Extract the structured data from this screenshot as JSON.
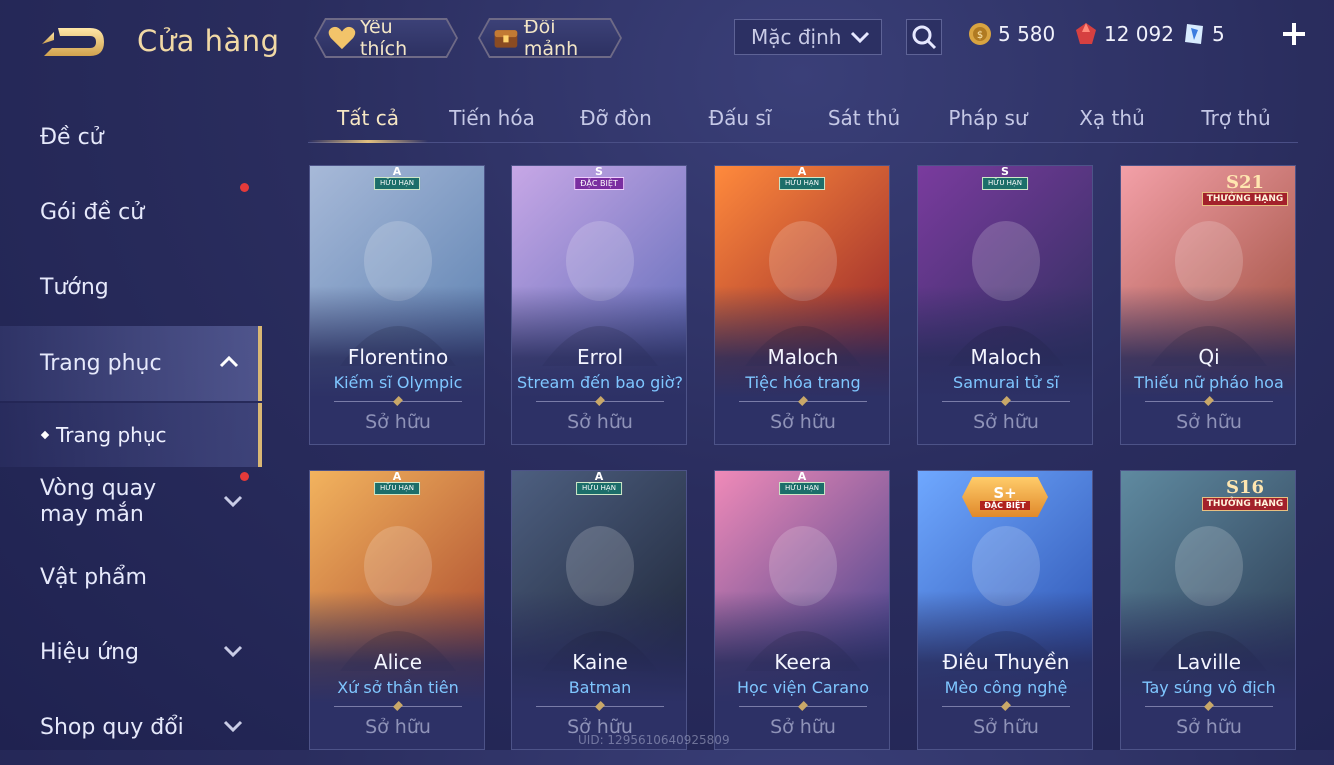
{
  "header": {
    "title": "Cửa hàng",
    "favorites_label": "Yêu thích",
    "exchange_label": "Đổi mảnh",
    "sort_value": "Mặc định",
    "currencies": [
      {
        "icon": "gold-coin-icon",
        "value": "5 580"
      },
      {
        "icon": "red-gem-icon",
        "value": "12 092"
      },
      {
        "icon": "blue-voucher-icon",
        "value": "5"
      }
    ]
  },
  "sidebar": {
    "items": [
      {
        "label": "Đề cử"
      },
      {
        "label": "Gói đề cử"
      },
      {
        "label": "Tướng"
      },
      {
        "label": "Trang phục"
      },
      {
        "label": "Trang phục"
      },
      {
        "label": "Vòng quay may mắn"
      },
      {
        "label": "Vật phẩm"
      },
      {
        "label": "Hiệu ứng"
      },
      {
        "label": "Shop quy đổi"
      }
    ]
  },
  "tabs": [
    "Tất cả",
    "Tiến hóa",
    "Đỡ đòn",
    "Đấu sĩ",
    "Sát thủ",
    "Pháp sư",
    "Xạ thủ",
    "Trợ thủ"
  ],
  "cards": [
    {
      "hero": "Florentino",
      "skin": "Kiếm sĩ Olympic",
      "status": "Sở hữu",
      "badge": {
        "letter": "A",
        "tag": "HỮU HẠN"
      },
      "colors": [
        "#5a7fb0",
        "#a7b9d8"
      ]
    },
    {
      "hero": "Errol",
      "skin": "Stream đến bao giờ?",
      "status": "Sở hữu",
      "badge": {
        "letter": "S",
        "tag": "ĐẶC BIỆT"
      },
      "colors": [
        "#5d6bb8",
        "#c7a7e6"
      ]
    },
    {
      "hero": "Maloch",
      "skin": "Tiệc hóa trang",
      "status": "Sở hữu",
      "badge": {
        "letter": "A",
        "tag": "HỮU HẠN"
      },
      "colors": [
        "#8e1f2a",
        "#ff8a3c"
      ]
    },
    {
      "hero": "Maloch",
      "skin": "Samurai tử sĩ",
      "status": "Sở hữu",
      "badge": {
        "letter": "S",
        "tag": "HỮU HẠN"
      },
      "colors": [
        "#2d2f5d",
        "#7a3b9e"
      ]
    },
    {
      "hero": "Qi",
      "skin": "Thiếu nữ pháo hoa",
      "status": "Sở hữu",
      "badge": {
        "big": "S21",
        "small": "THƯỞNG HẠNG"
      },
      "colors": [
        "#9a4b3a",
        "#f3a0a8"
      ]
    },
    {
      "hero": "Alice",
      "skin": "Xứ sở thần tiên",
      "status": "Sở hữu",
      "badge": {
        "letter": "A",
        "tag": "HỮU HẠN"
      },
      "colors": [
        "#a8452c",
        "#f2b35e"
      ]
    },
    {
      "hero": "Kaine",
      "skin": "Batman",
      "status": "Sở hữu",
      "badge": {
        "letter": "A",
        "tag": "HỮU HẠN"
      },
      "colors": [
        "#1d2436",
        "#4d5f80"
      ]
    },
    {
      "hero": "Keera",
      "skin": "Học viện Carano",
      "status": "Sở hữu",
      "badge": {
        "letter": "A",
        "tag": "HỮU HẠN"
      },
      "colors": [
        "#3b3f8a",
        "#f08ab8"
      ]
    },
    {
      "hero": "Điêu Thuyền",
      "skin": "Mèo công nghệ",
      "status": "Sở hữu",
      "badge": {
        "big": "S+",
        "small": "ĐẶC BIỆT"
      },
      "colors": [
        "#2a4fae",
        "#6fa8ff"
      ]
    },
    {
      "hero": "Laville",
      "skin": "Tay súng vô địch",
      "status": "Sở hữu",
      "badge": {
        "big": "S16",
        "small": "THƯỞNG HẠNG"
      },
      "colors": [
        "#2b3a52",
        "#5f8aa0"
      ]
    }
  ],
  "watermark": "UID: 1295610640925809"
}
